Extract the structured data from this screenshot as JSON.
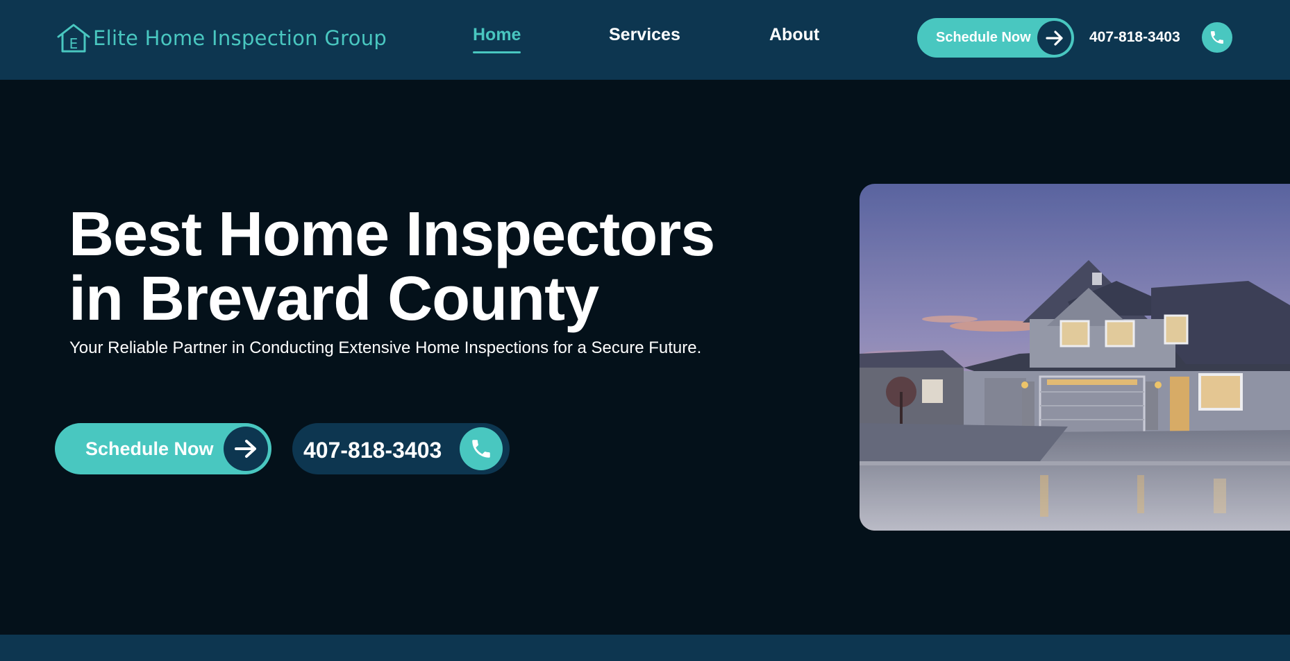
{
  "header": {
    "logo_text": "Elite Home Inspection Group",
    "logo_icon": "house-e-icon",
    "nav": [
      {
        "label": "Home",
        "active": true
      },
      {
        "label": "Services",
        "active": false
      },
      {
        "label": "About",
        "active": false
      }
    ],
    "schedule_label": "Schedule Now",
    "phone": "407-818-3403"
  },
  "hero": {
    "title_line1": "Best Home Inspectors",
    "title_line2": "in Brevard County",
    "subtitle": "Your Reliable Partner in Conducting Extensive Home Inspections for a Secure Future.",
    "schedule_label": "Schedule Now",
    "phone": "407-818-3403",
    "image_icon": "house-photo"
  },
  "colors": {
    "accent": "#49c7c0",
    "header_bg": "#0d3650",
    "page_bg": "#04111a",
    "text": "#ffffff"
  }
}
